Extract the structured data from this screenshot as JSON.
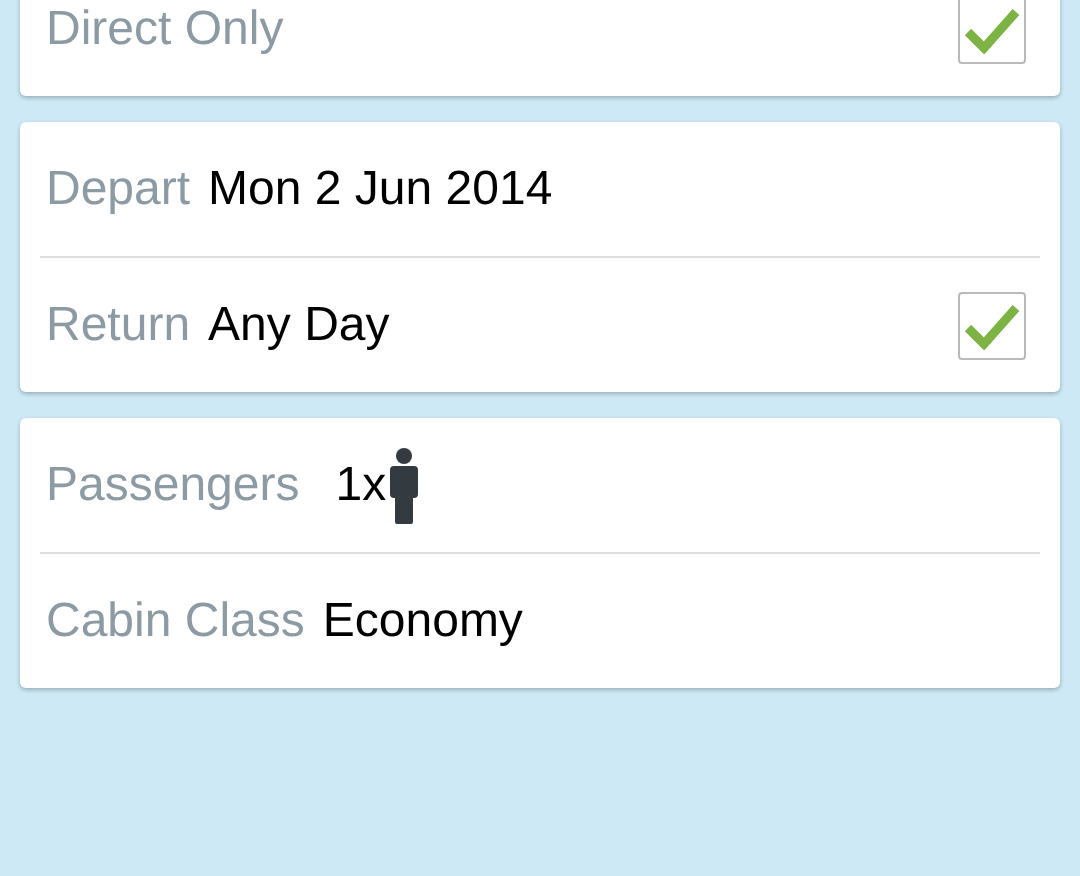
{
  "cards": [
    {
      "rows": [
        {
          "kind": "check",
          "label": "Direct Only",
          "checked": true
        }
      ]
    },
    {
      "rows": [
        {
          "kind": "text",
          "label": "Depart",
          "value": "Mon 2 Jun 2014"
        },
        {
          "kind": "check",
          "label": "Return",
          "value": "Any Day",
          "checked": true
        }
      ]
    },
    {
      "rows": [
        {
          "kind": "passengers",
          "label": "Passengers",
          "value": "1x"
        },
        {
          "kind": "text",
          "label": "Cabin Class",
          "value": "Economy"
        }
      ]
    }
  ]
}
